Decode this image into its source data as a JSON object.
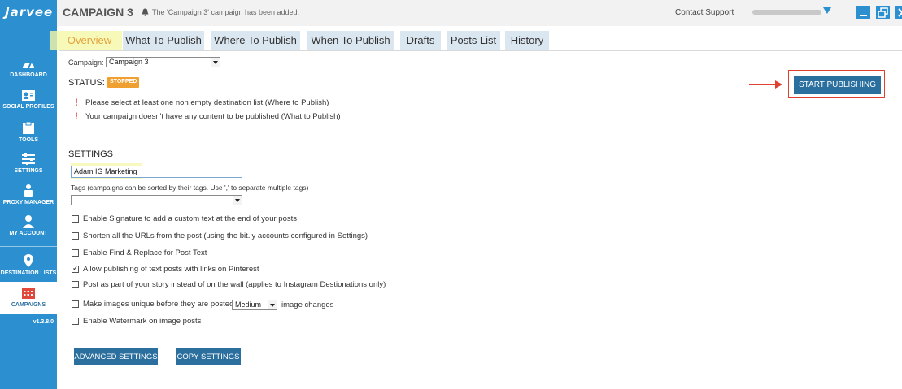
{
  "app": {
    "logo": "Jarvee",
    "version": "v1.3.8.0"
  },
  "sidebar": {
    "items": [
      {
        "label": "DASHBOARD",
        "icon": "dashboard-icon"
      },
      {
        "label": "SOCIAL PROFILES",
        "icon": "profiles-icon"
      },
      {
        "label": "TOOLS",
        "icon": "tools-icon"
      },
      {
        "label": "SETTINGS",
        "icon": "settings-icon"
      },
      {
        "label": "PROXY MANAGER",
        "icon": "proxy-icon"
      },
      {
        "label": "MY ACCOUNT",
        "icon": "user-icon"
      },
      {
        "label": "DESTINATION LISTS",
        "icon": "location-icon"
      },
      {
        "label": "CAMPAIGNS",
        "icon": "calendar-icon",
        "active": true
      }
    ]
  },
  "header": {
    "title": "CAMPAIGN 3",
    "notification": "The 'Campaign 3' campaign has been added.",
    "contact_support": "Contact Support"
  },
  "tabs": [
    {
      "label": "Overview",
      "active": true
    },
    {
      "label": "What To Publish"
    },
    {
      "label": "Where To Publish"
    },
    {
      "label": "When To Publish"
    },
    {
      "label": "Drafts"
    },
    {
      "label": "Posts List"
    },
    {
      "label": "History"
    }
  ],
  "campaign": {
    "label": "Campaign:",
    "selected": "Campaign 3"
  },
  "status": {
    "label": "STATUS:",
    "badge": "STOPPED",
    "badge_color": "#f0a030",
    "warnings": [
      "Please select at least one non empty destination list (Where to Publish)",
      "Your campaign doesn't have any content to be published (What to Publish)"
    ]
  },
  "start_button": "START PUBLISHING",
  "settings": {
    "title": "SETTINGS",
    "name_value": "Adam IG Marketing",
    "tags_label": "Tags (campaigns can be sorted by their tags. Use ',' to separate multiple tags)",
    "tags_value": "",
    "options": [
      {
        "label": "Enable Signature to add a custom text at the end of your posts",
        "checked": false
      },
      {
        "label": "Shorten all the URLs from the post (using the bit.ly accounts configured in Settings)",
        "checked": false
      },
      {
        "label": "Enable Find & Replace for Post Text",
        "checked": false
      },
      {
        "label": "Allow publishing of text posts with links on Pinterest",
        "checked": true
      },
      {
        "label": "Post as part of your story instead of on the wall (applies to Instagram Destionations only)",
        "checked": false
      },
      {
        "label": "Make images unique before they are posted",
        "checked": false,
        "select": "Medium",
        "suffix": "image changes"
      },
      {
        "label": "Enable Watermark on image posts",
        "checked": false
      }
    ],
    "advanced_button": "ADVANCED SETTINGS",
    "copy_button": "COPY SETTINGS"
  },
  "colors": {
    "sidebar": "#2b8fd0",
    "button": "#2a6f9e",
    "highlight": "#f5f7a8",
    "arrow": "#e04030"
  }
}
